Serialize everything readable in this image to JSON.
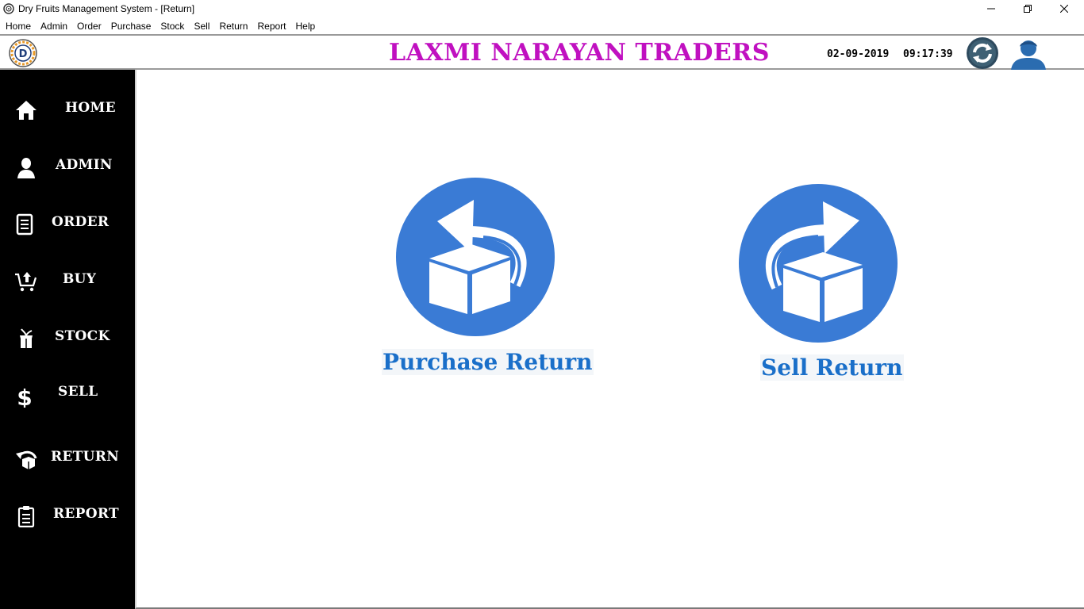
{
  "window": {
    "title": "Dry Fruits Management System - [Return]"
  },
  "menu": {
    "items": [
      "Home",
      "Admin",
      "Order",
      "Purchase",
      "Stock",
      "Sell",
      "Return",
      "Report",
      "Help"
    ]
  },
  "header": {
    "company": "LAXMI NARAYAN TRADERS",
    "date": "02-09-2019",
    "time": "09:17:39",
    "logo_letter": "D"
  },
  "sidebar": {
    "items": [
      {
        "label": "HOME",
        "icon": "home-icon"
      },
      {
        "label": "ADMIN",
        "icon": "admin-icon"
      },
      {
        "label": "ORDER",
        "icon": "order-icon"
      },
      {
        "label": "BUY",
        "icon": "cart-icon"
      },
      {
        "label": "STOCK",
        "icon": "stock-icon"
      },
      {
        "label": "SELL",
        "icon": "dollar-icon"
      },
      {
        "label": "RETURN",
        "icon": "return-icon"
      },
      {
        "label": "REPORT",
        "icon": "report-icon"
      }
    ]
  },
  "main": {
    "purchase_return_label": "Purchase Return",
    "sell_return_label": "Sell Return"
  },
  "colors": {
    "brand_title": "#c010c0",
    "tile_blue": "#3a7bd5",
    "label_blue": "#1a6fc9",
    "sidebar_bg": "#000000"
  }
}
